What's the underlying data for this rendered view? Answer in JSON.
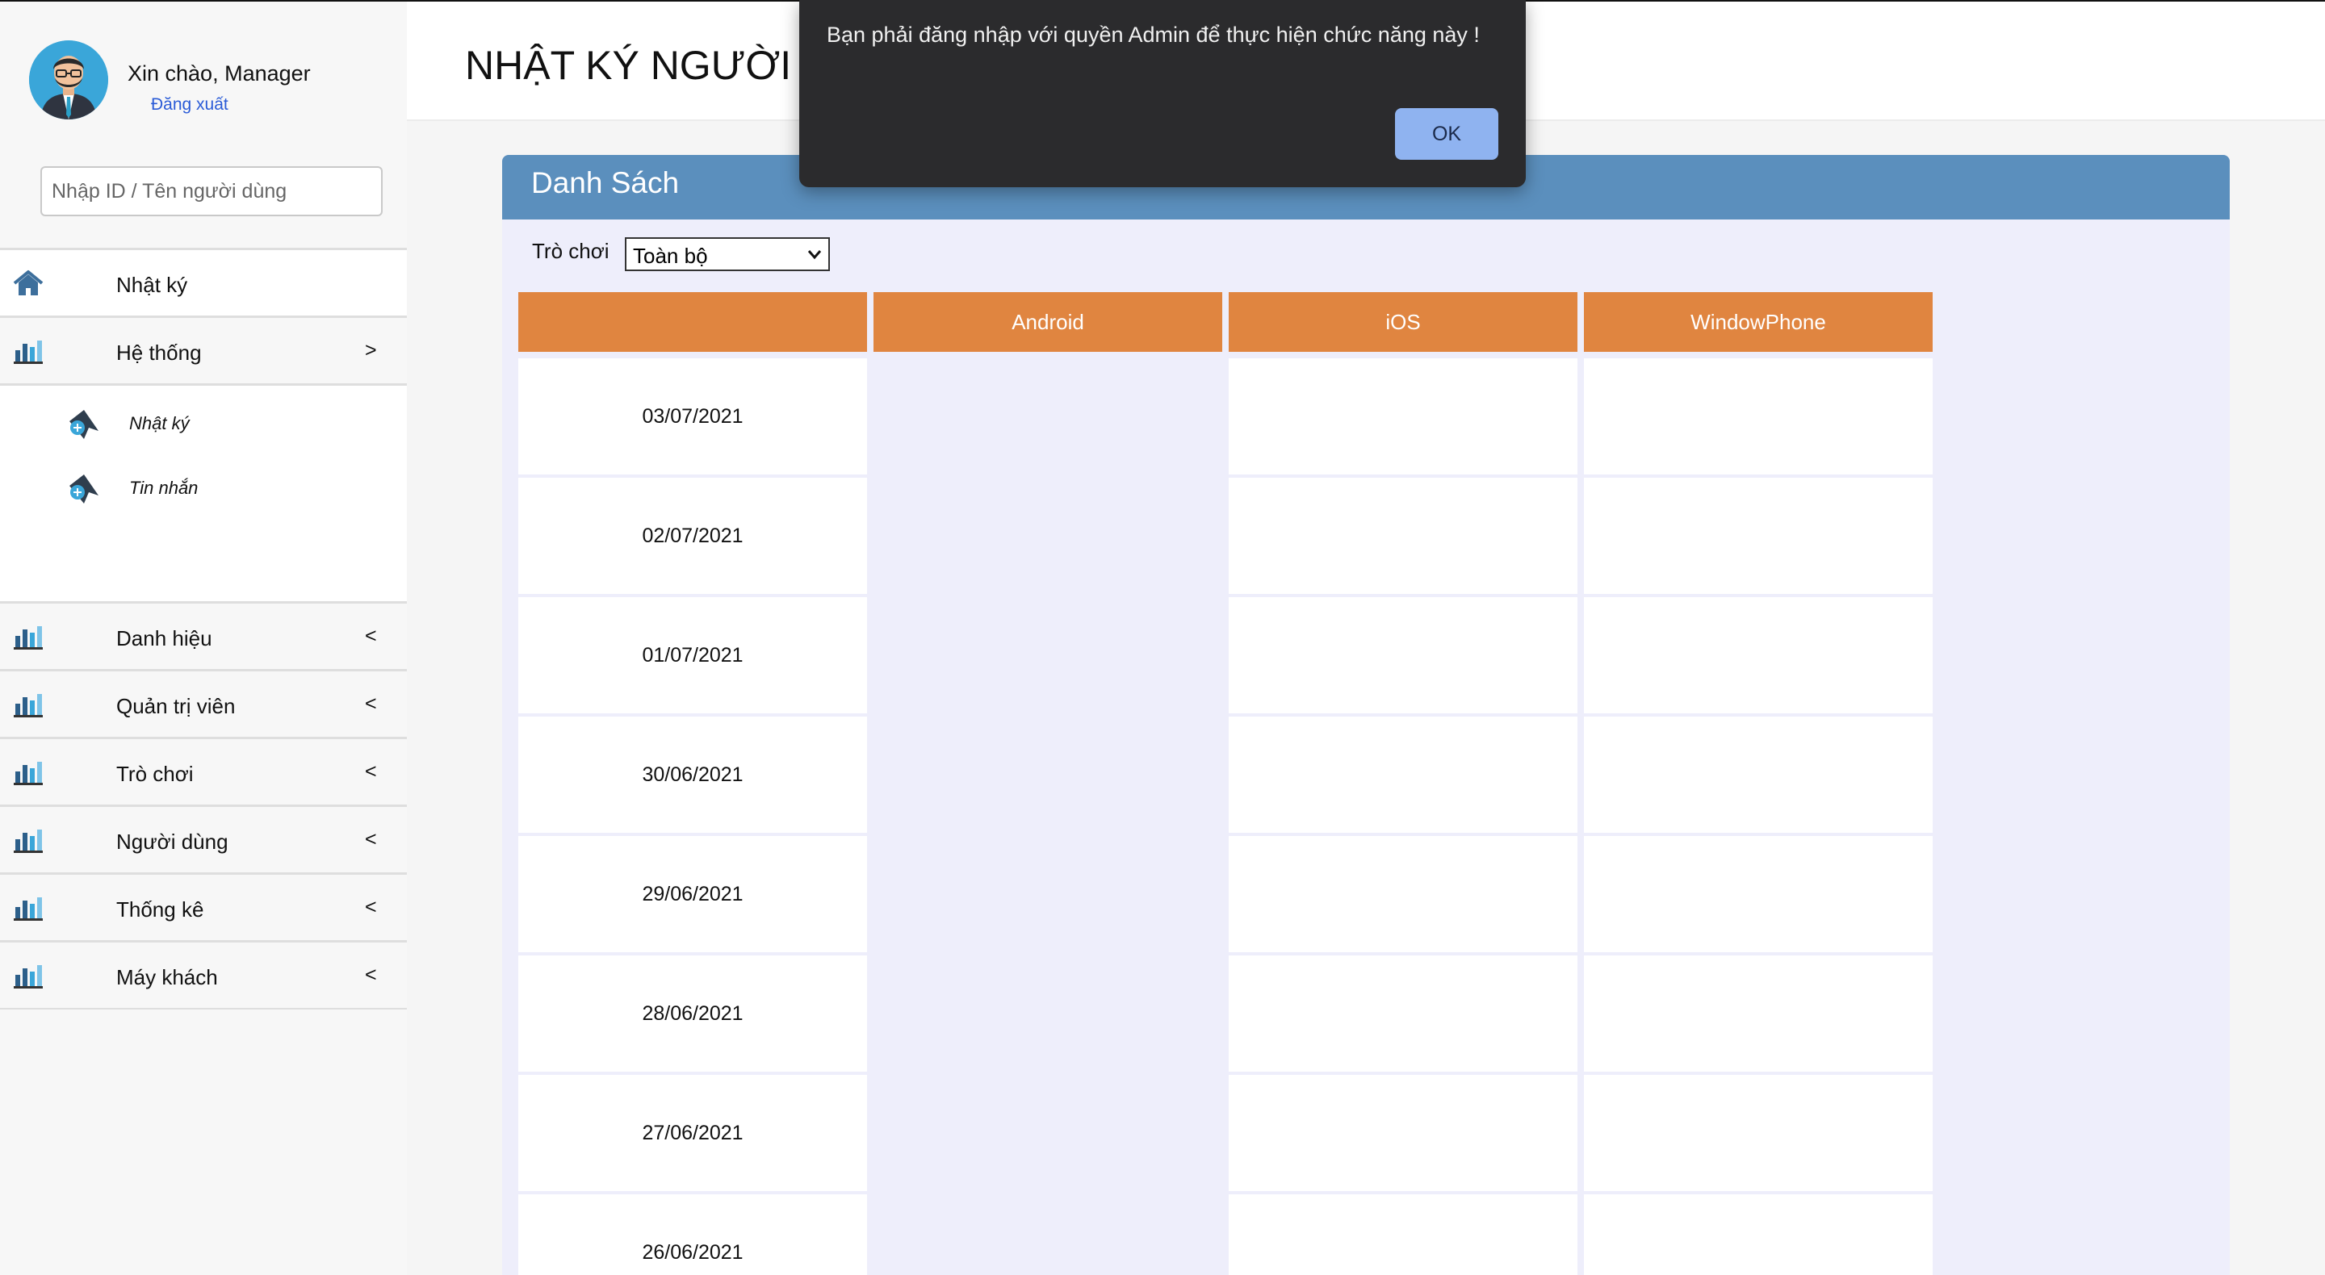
{
  "sidebar": {
    "greeting": "Xin chào, Manager",
    "logout": "Đăng xuất",
    "search_placeholder": "Nhập ID / Tên người dùng",
    "items": [
      {
        "label": "Nhật ký",
        "arrow": "",
        "icon": "home-icon"
      },
      {
        "label": "Hệ thống",
        "arrow": ">",
        "icon": "bar-chart-icon"
      },
      {
        "label": "Danh hiệu",
        "arrow": "<",
        "icon": "bar-chart-icon"
      },
      {
        "label": "Quản trị viên",
        "arrow": "<",
        "icon": "bar-chart-icon"
      },
      {
        "label": "Trò chơi",
        "arrow": "<",
        "icon": "bar-chart-icon"
      },
      {
        "label": "Người dùng",
        "arrow": "<",
        "icon": "bar-chart-icon"
      },
      {
        "label": "Thống kê",
        "arrow": "<",
        "icon": "bar-chart-icon"
      },
      {
        "label": "Máy khách",
        "arrow": "<",
        "icon": "bar-chart-icon"
      }
    ],
    "subitems": [
      {
        "label": "Nhật ký",
        "icon": "pin-add-icon"
      },
      {
        "label": "Tin nhắn",
        "icon": "pin-add-icon"
      }
    ]
  },
  "header": {
    "title": "NHẬT KÝ NGƯỜI D"
  },
  "panel": {
    "title": "Danh Sách",
    "filter_label": "Trò chơi",
    "filter_value": "Toàn bộ"
  },
  "table": {
    "columns": [
      "",
      "Android",
      "iOS",
      "WindowPhone"
    ],
    "rows": [
      "03/07/2021",
      "02/07/2021",
      "01/07/2021",
      "30/06/2021",
      "29/06/2021",
      "28/06/2021",
      "27/06/2021",
      "26/06/2021"
    ]
  },
  "alert": {
    "message": "Bạn phải đăng nhập với quyền Admin để thực hiện chức năng này !",
    "ok_label": "OK"
  },
  "colors": {
    "panel_header": "#5b8fbd",
    "table_header": "#e08540",
    "panel_bg": "#eeeefb",
    "alert_bg": "#2b2b2d",
    "alert_button": "#8fb3f0",
    "link": "#2a5bd7"
  }
}
